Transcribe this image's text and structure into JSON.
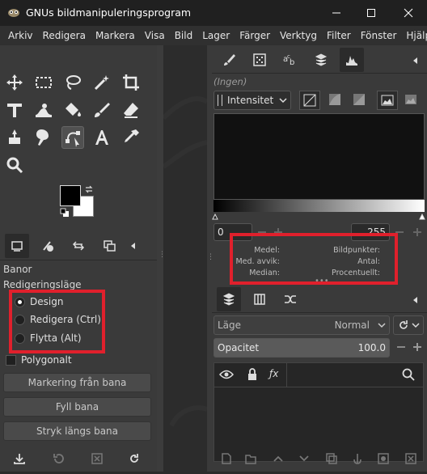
{
  "titlebar": {
    "title": "GNUs bildmanipuleringsprogram"
  },
  "menu": [
    "Arkiv",
    "Redigera",
    "Markera",
    "Visa",
    "Bild",
    "Lager",
    "Färger",
    "Verktyg",
    "Filter",
    "Fönster",
    "Hjälp"
  ],
  "tool_options": {
    "title": "Banor",
    "mode_label": "Redigeringsläge",
    "modes": [
      {
        "label": "Design",
        "selected": true
      },
      {
        "label": "Redigera (Ctrl)",
        "selected": false
      },
      {
        "label": "Flytta (Alt)",
        "selected": false
      }
    ],
    "polygonal_label": "Polygonalt",
    "buttons": [
      "Markering från bana",
      "Fyll bana",
      "Stryk längs bana"
    ]
  },
  "histogram": {
    "channel_placeholder": "(Ingen)",
    "channel_select": "Intensitet",
    "range_min": "0",
    "range_max": "255",
    "stats_left": [
      "Medel:",
      "Med. avvik:",
      "Median:"
    ],
    "stats_right": [
      "Bildpunkter:",
      "Antal:",
      "Procentuellt:"
    ]
  },
  "layers": {
    "mode_label": "Läge",
    "mode_value": "Normal",
    "opacity_label": "Opacitet",
    "opacity_value": "100.0"
  },
  "colors": {
    "accent_red": "#e0202c",
    "fg_color": "#000000",
    "bg_color": "#ffffff"
  }
}
